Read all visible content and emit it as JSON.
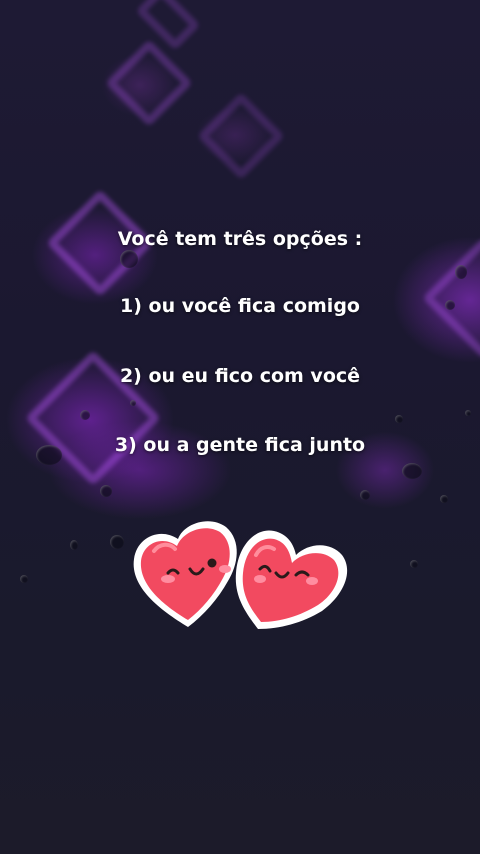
{
  "message": {
    "title": "Você tem três opções :",
    "options": [
      "1) ou você fica comigo",
      "2) ou eu fico com você",
      "3) ou a gente fica junto"
    ]
  },
  "sticker": {
    "icon": "two-smiling-hearts-icon",
    "heart_color": "#f24a60",
    "outline_color": "#ffffff"
  },
  "background": {
    "base_color": "#1c1930",
    "glow_color": "#a040e0"
  }
}
